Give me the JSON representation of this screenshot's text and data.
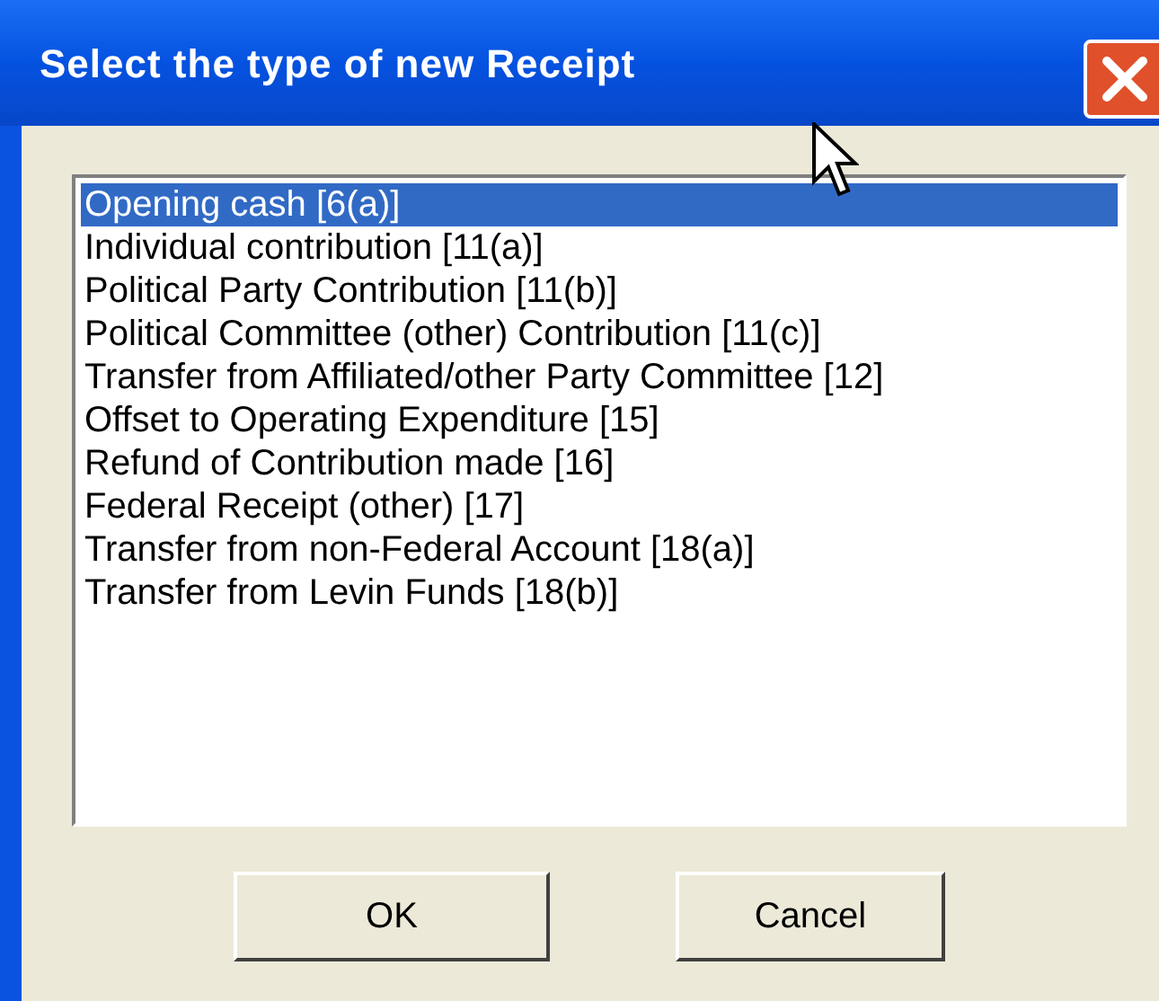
{
  "window": {
    "title": "Select the type of new Receipt"
  },
  "list": {
    "items": [
      {
        "label": "Opening cash [6(a)]",
        "selected": true
      },
      {
        "label": "Individual contribution [11(a)]",
        "selected": false
      },
      {
        "label": "Political Party Contribution [11(b)]",
        "selected": false
      },
      {
        "label": "Political Committee (other) Contribution [11(c)]",
        "selected": false
      },
      {
        "label": "Transfer from Affiliated/other Party Committee [12]",
        "selected": false
      },
      {
        "label": "Offset to Operating Expenditure [15]",
        "selected": false
      },
      {
        "label": "Refund of Contribution made [16]",
        "selected": false
      },
      {
        "label": "Federal Receipt (other) [17]",
        "selected": false
      },
      {
        "label": "Transfer from non-Federal Account [18(a)]",
        "selected": false
      },
      {
        "label": "Transfer from Levin Funds [18(b)]",
        "selected": false
      }
    ]
  },
  "buttons": [
    "OK",
    "Cancel"
  ]
}
